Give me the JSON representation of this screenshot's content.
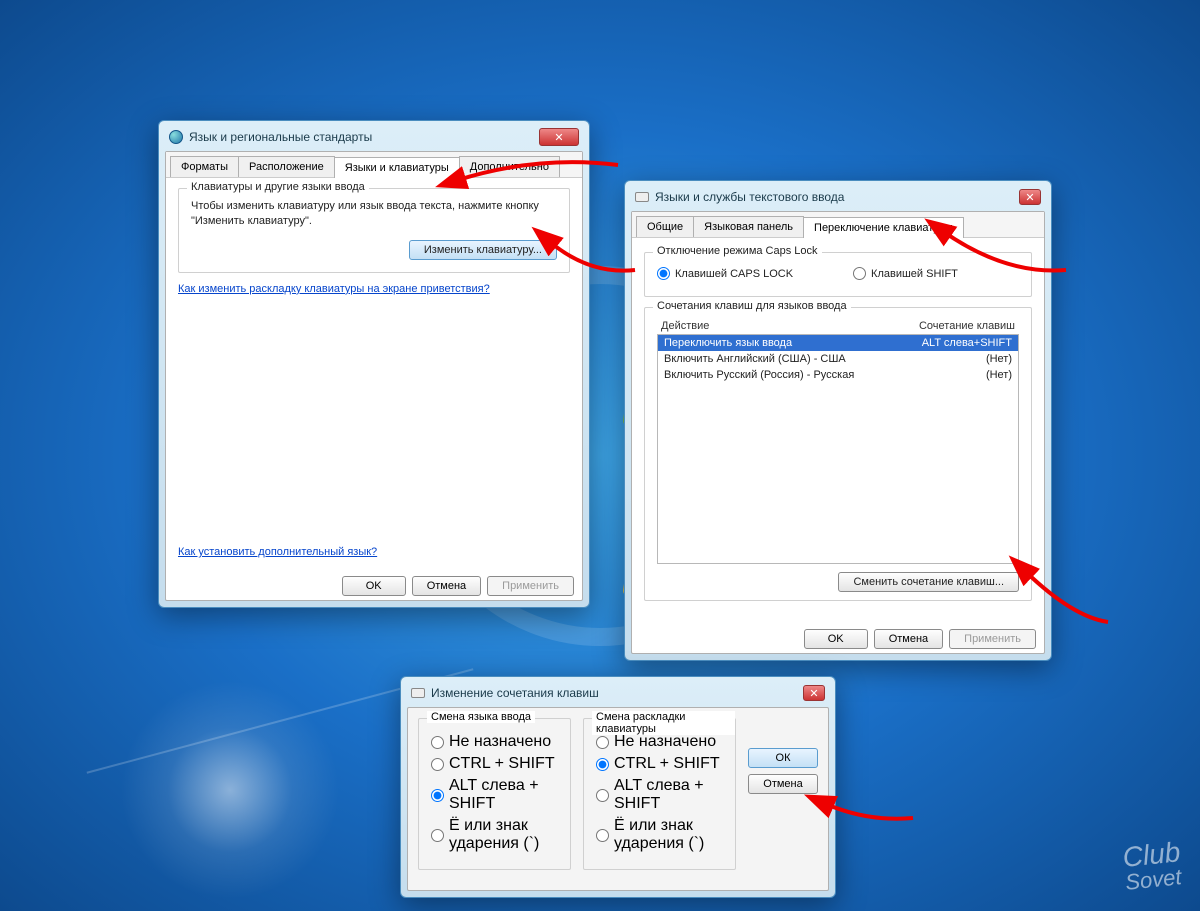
{
  "dlg1": {
    "title": "Язык и региональные стандарты",
    "tabs": [
      "Форматы",
      "Расположение",
      "Языки и клавиатуры",
      "Дополнительно"
    ],
    "groupLegend": "Клавиатуры и другие языки ввода",
    "groupText": "Чтобы изменить клавиатуру или язык ввода текста, нажмите кнопку \"Изменить клавиатуру\".",
    "changeKbdBtn": "Изменить клавиатуру...",
    "link1": "Как изменить раскладку клавиатуры на экране приветствия?",
    "link2": "Как установить дополнительный язык?",
    "ok": "OK",
    "cancel": "Отмена",
    "apply": "Применить"
  },
  "dlg2": {
    "title": "Языки и службы текстового ввода",
    "tabs": [
      "Общие",
      "Языковая панель",
      "Переключение клавиатуры"
    ],
    "caps": {
      "legend": "Отключение режима Caps Lock",
      "opt1": "Клавишей CAPS LOCK",
      "opt2": "Клавишей SHIFT"
    },
    "hot": {
      "legend": "Сочетания клавиш для языков ввода",
      "colAction": "Действие",
      "colCombo": "Сочетание клавиш",
      "rows": [
        {
          "a": "Переключить язык ввода",
          "c": "ALT слева+SHIFT"
        },
        {
          "a": "Включить Английский (США) - США",
          "c": "(Нет)"
        },
        {
          "a": "Включить Русский (Россия) - Русская",
          "c": "(Нет)"
        }
      ],
      "changeBtn": "Сменить сочетание клавиш..."
    },
    "ok": "OK",
    "cancel": "Отмена",
    "apply": "Применить"
  },
  "dlg3": {
    "title": "Изменение сочетания клавиш",
    "left": {
      "legend": "Смена языка ввода",
      "o1": "Не назначено",
      "o2": "CTRL + SHIFT",
      "o3": "ALT слева + SHIFT",
      "o4": "Ё или знак ударения (`)"
    },
    "right": {
      "legend": "Смена раскладки клавиатуры",
      "o1": "Не назначено",
      "o2": "CTRL + SHIFT",
      "o3": "ALT слева + SHIFT",
      "o4": "Ё или знак ударения (`)"
    },
    "ok": "ОК",
    "cancel": "Отмена"
  },
  "watermark": {
    "a": "Club",
    "b": "Sovet"
  }
}
